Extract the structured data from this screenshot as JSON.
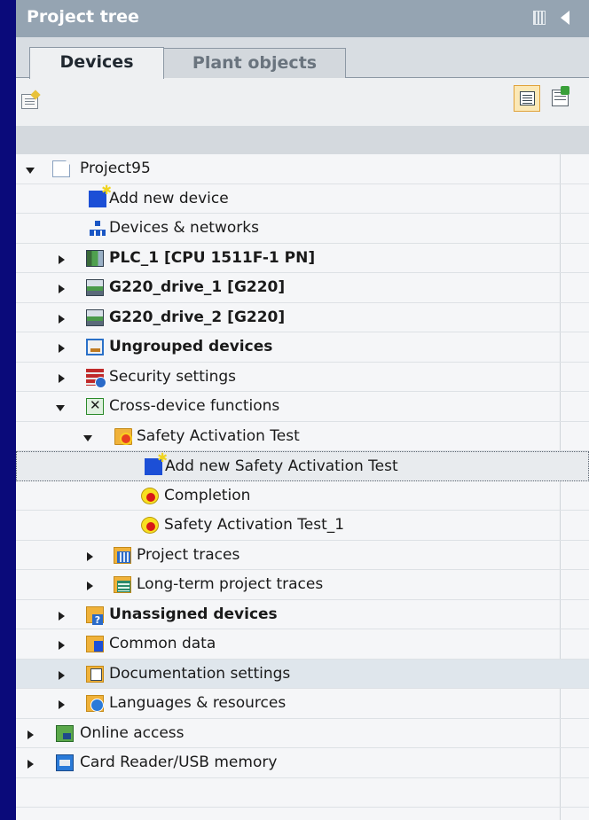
{
  "panel": {
    "title": "Project tree",
    "pin_icon": "pin-icon",
    "collapse_icon": "collapse-arrow-icon"
  },
  "tabs": [
    {
      "label": "Devices",
      "active": true
    },
    {
      "label": "Plant objects",
      "active": false
    }
  ],
  "toolbar": {
    "left_icon": "new-from-template-icon",
    "right_icons": [
      "overview-view-icon",
      "table-export-icon"
    ]
  },
  "tree": {
    "items": [
      {
        "label": "Project95",
        "icon": "project-document-icon",
        "expanded": true
      },
      {
        "label": "Add new device",
        "icon": "add-new-device-icon"
      },
      {
        "label": "Devices & networks",
        "icon": "network-icon"
      },
      {
        "label": "PLC_1 [CPU 1511F-1 PN]",
        "icon": "plc-icon",
        "expanded": false
      },
      {
        "label": "G220_drive_1 [G220]",
        "icon": "drive-icon",
        "expanded": false
      },
      {
        "label": "G220_drive_2 [G220]",
        "icon": "drive-icon",
        "expanded": false
      },
      {
        "label": "Ungrouped devices",
        "icon": "ungrouped-devices-icon",
        "expanded": false
      },
      {
        "label": "Security settings",
        "icon": "security-settings-icon",
        "expanded": false
      },
      {
        "label": "Cross-device functions",
        "icon": "cross-device-functions-icon",
        "expanded": true
      },
      {
        "label": "Safety Activation Test",
        "icon": "safety-folder-icon",
        "expanded": true
      },
      {
        "label": "Add new Safety Activation Test",
        "icon": "add-new-icon",
        "selected": true
      },
      {
        "label": "Completion",
        "icon": "safety-test-icon"
      },
      {
        "label": "Safety Activation Test_1",
        "icon": "safety-test-icon"
      },
      {
        "label": "Project traces",
        "icon": "project-traces-icon",
        "expanded": false
      },
      {
        "label": "Long-term project traces",
        "icon": "long-term-traces-icon",
        "expanded": false
      },
      {
        "label": "Unassigned devices",
        "icon": "unassigned-devices-icon",
        "expanded": false
      },
      {
        "label": "Common data",
        "icon": "common-data-icon",
        "expanded": false
      },
      {
        "label": "Documentation settings",
        "icon": "documentation-settings-icon",
        "expanded": false
      },
      {
        "label": "Languages & resources",
        "icon": "languages-resources-icon",
        "expanded": false
      },
      {
        "label": "Online access",
        "icon": "online-access-icon",
        "expanded": false
      },
      {
        "label": "Card Reader/USB memory",
        "icon": "card-reader-icon",
        "expanded": false
      }
    ]
  },
  "colors": {
    "background": "#0a0a7a",
    "titlebar": "#95a4b2",
    "panel": "#eef0f2",
    "accent": "#f0b23a"
  }
}
